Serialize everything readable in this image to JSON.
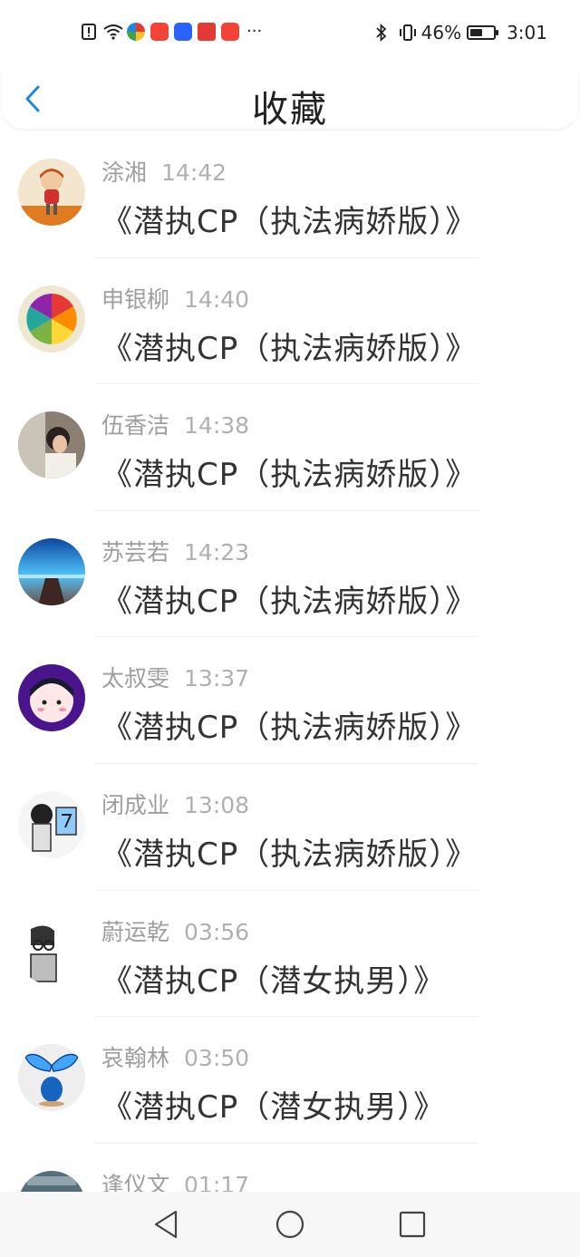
{
  "status_bar": {
    "battery": "46%",
    "time": "3:01",
    "more": "···"
  },
  "header": {
    "title": "收藏"
  },
  "items": [
    {
      "name": "涂湘",
      "time": "14:42",
      "title": "《潜执CP（执法病娇版）》"
    },
    {
      "name": "申银柳",
      "time": "14:40",
      "title": "《潜执CP（执法病娇版）》"
    },
    {
      "name": "伍香洁",
      "time": "14:38",
      "title": "《潜执CP（执法病娇版）》"
    },
    {
      "name": "苏芸若",
      "time": "14:23",
      "title": "《潜执CP（执法病娇版）》"
    },
    {
      "name": "太叔雯",
      "time": "13:37",
      "title": "《潜执CP（执法病娇版）》"
    },
    {
      "name": "闭成业",
      "time": "13:08",
      "title": "《潜执CP（执法病娇版）》"
    },
    {
      "name": "蔚运乾",
      "time": "03:56",
      "title": "《潜执CP（潜女执男）》"
    },
    {
      "name": "哀翰林",
      "time": "03:50",
      "title": "《潜执CP（潜女执男）》"
    },
    {
      "name": "逢仪文",
      "time": "01:17",
      "title": ""
    }
  ],
  "colors": {
    "accent": "#1e88e5",
    "name_text": "#9e9e9e",
    "title_text": "#333333"
  }
}
